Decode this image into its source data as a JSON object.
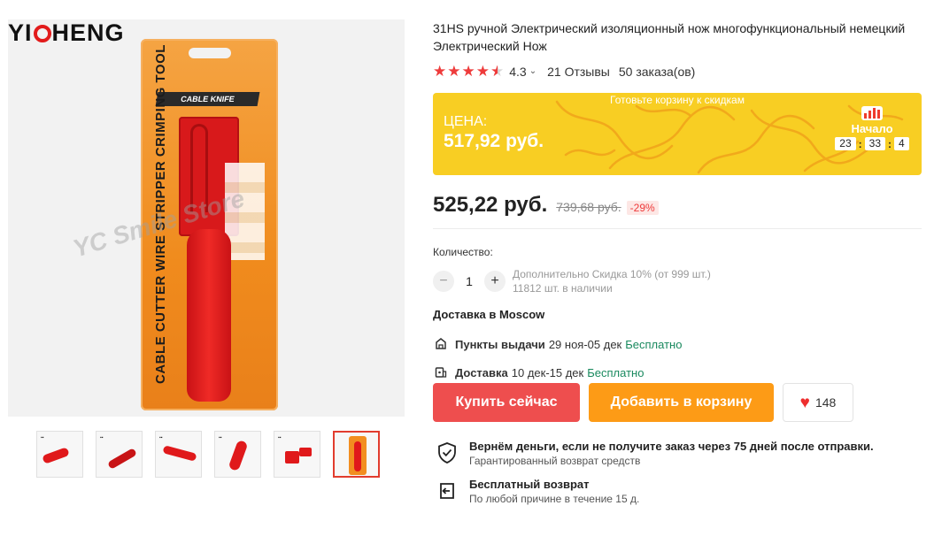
{
  "gallery": {
    "brand": {
      "left": "YI",
      "right": "HENG"
    },
    "package_label": "CABLE KNIFE",
    "package_text": "CABLE CUTTER WIRE STRIPPER CRIMPING TOOL",
    "watermark": "YC Smile Store",
    "thumbnails": [
      {
        "name": "thumb-1",
        "active": false
      },
      {
        "name": "thumb-2",
        "active": false
      },
      {
        "name": "thumb-3",
        "active": false
      },
      {
        "name": "thumb-4",
        "active": false
      },
      {
        "name": "thumb-5",
        "active": false
      },
      {
        "name": "thumb-6",
        "active": true
      }
    ]
  },
  "product": {
    "title": "31HS ручной Электрический изоляционный нож многофункциональный немецкий Электрический Нож",
    "rating": {
      "value": "4.3",
      "stars_filled": 4.3,
      "reviews": "21 Отзывы",
      "orders": "50 заказа(ов)"
    }
  },
  "promo": {
    "banner": "Готовьте корзину к скидкам",
    "price_label": "ЦЕНА:",
    "price": "517,92 руб.",
    "start_label": "Начало",
    "timer": {
      "hours": "23",
      "minutes": "33",
      "seconds": "4"
    },
    "colors": {
      "background": "#f8ce23",
      "accent": "#ef3b2d"
    }
  },
  "price": {
    "current": "525,22 руб.",
    "old": "739,68 руб.",
    "discount": "-29%"
  },
  "quantity": {
    "label": "Количество:",
    "value": "1",
    "minus": "−",
    "plus": "+",
    "extra_discount": "Дополнительно Скидка 10% (от 999 шт.)",
    "stock": "11812 шт. в наличии"
  },
  "delivery": {
    "title": "Доставка в Moscow",
    "pickup": {
      "label": "Пункты выдачи",
      "dates": "29 ноя-05 дек",
      "price": "Бесплатно"
    },
    "courier": {
      "label": "Доставка",
      "dates": "10 дек-15 дек",
      "price": "Бесплатно"
    }
  },
  "actions": {
    "buy_now": "Купить сейчас",
    "add_to_cart": "Добавить в корзину",
    "wishlist_count": "148",
    "colors": {
      "buy": "#ee4e4e",
      "cart": "#fd9b16"
    }
  },
  "guarantees": [
    {
      "title": "Вернём деньги, если не получите заказ через 75 дней после отправки.",
      "subtitle": "Гарантированный возврат средств",
      "icon": "shield-check-icon"
    },
    {
      "title": "Бесплатный возврат",
      "subtitle": "По любой причине в течение 15 д.",
      "icon": "return-box-icon"
    }
  ]
}
